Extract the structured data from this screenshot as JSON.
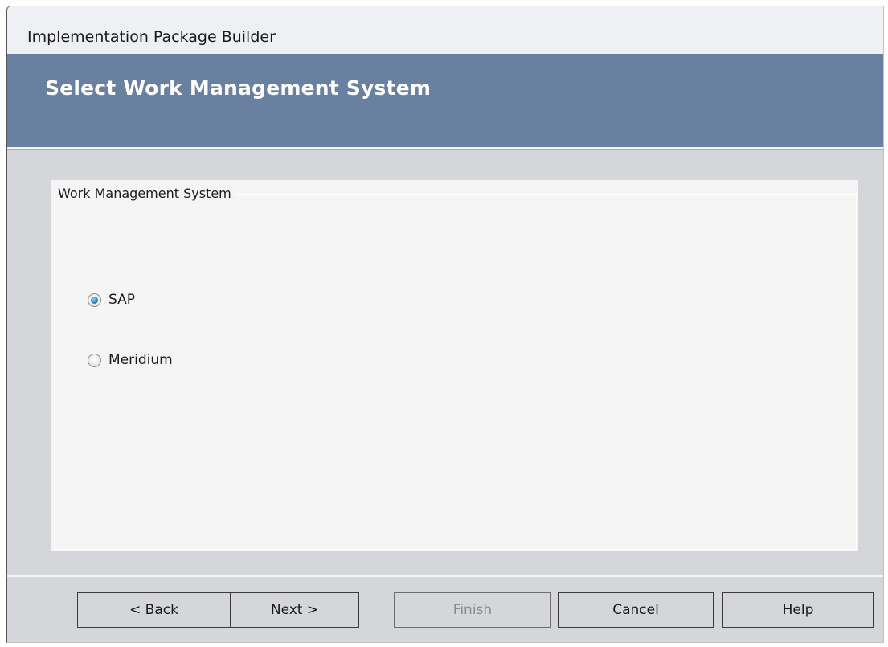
{
  "window": {
    "title": "Implementation Package Builder"
  },
  "header": {
    "title": "Select Work Management System"
  },
  "group": {
    "legend": "Work Management System",
    "options": [
      {
        "label": "SAP",
        "checked": true
      },
      {
        "label": "Meridium",
        "checked": false
      }
    ]
  },
  "footer": {
    "buttons": [
      {
        "label": "< Back",
        "enabled": true
      },
      {
        "label": "Next >",
        "enabled": true
      },
      {
        "label": "Finish",
        "enabled": false
      },
      {
        "label": "Cancel",
        "enabled": true
      },
      {
        "label": "Help",
        "enabled": true
      }
    ]
  },
  "colors": {
    "header_band": "#6980a0",
    "radio_accent": "#2f86c8",
    "window_bg": "#d4d6d9"
  }
}
